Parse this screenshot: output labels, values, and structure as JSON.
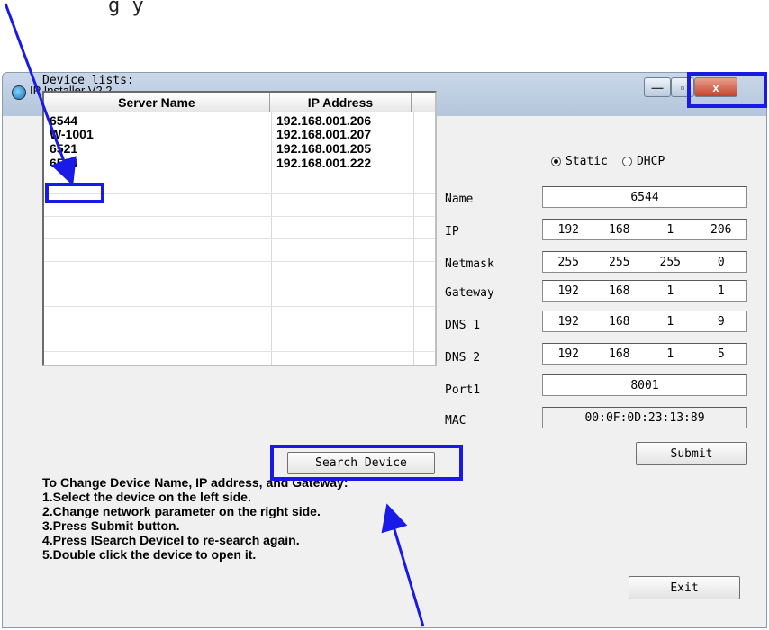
{
  "caption": "g        y",
  "window": {
    "title": "IP Installer V2.2",
    "minimize_label": "—",
    "maximize_label": "▫",
    "close_label": "x"
  },
  "device_list": {
    "label": "Device lists:",
    "columns": [
      "Server Name",
      "IP Address"
    ],
    "rows": [
      {
        "name": "6544",
        "ip": "192.168.001.206"
      },
      {
        "name": "W-1001",
        "ip": "192.168.001.207"
      },
      {
        "name": "6521",
        "ip": "192.168.001.205"
      },
      {
        "name": "6524",
        "ip": "192.168.001.222"
      }
    ]
  },
  "mode": {
    "static_label": "Static",
    "dhcp_label": "DHCP",
    "selected": "Static"
  },
  "fields": {
    "name_label": "Name",
    "name_value": "6544",
    "ip_label": "IP",
    "ip": [
      "192",
      "168",
      "1",
      "206"
    ],
    "netmask_label": "Netmask",
    "netmask": [
      "255",
      "255",
      "255",
      "0"
    ],
    "gateway_label": "Gateway",
    "gateway": [
      "192",
      "168",
      "1",
      "1"
    ],
    "dns1_label": "DNS 1",
    "dns1": [
      "192",
      "168",
      "1",
      "9"
    ],
    "dns2_label": "DNS 2",
    "dns2": [
      "192",
      "168",
      "1",
      "5"
    ],
    "port1_label": "Port1",
    "port1_value": "8001",
    "mac_label": "MAC",
    "mac_value": "00:0F:0D:23:13:89"
  },
  "buttons": {
    "search": "Search Device",
    "submit": "Submit",
    "exit": "Exit"
  },
  "instructions": [
    "To Change Device Name, IP address, and Gateway:",
    "1.Select the device on the left side.",
    "2.Change network parameter on the right side.",
    "3.Press Submit button.",
    "4.Press ISearch DeviceI to re-search again.",
    "5.Double click the device to open it."
  ],
  "annotation_color": "#1a1ae8"
}
